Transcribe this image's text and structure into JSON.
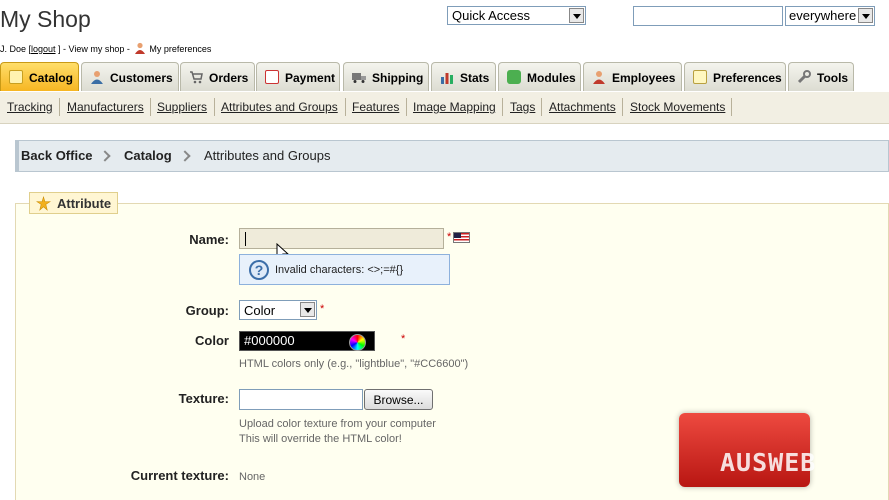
{
  "header": {
    "shop_title": "My Shop",
    "user_name": "J. Doe [",
    "logout_label": "logout",
    "user_mid": " ] - ",
    "view_shop": "View my shop",
    "dash": " - ",
    "preferences_link": "My preferences"
  },
  "top_controls": {
    "quick_access": "Quick Access",
    "search_value": "",
    "search_scope": "everywhere"
  },
  "tabs": [
    {
      "label": "Catalog",
      "icon": "catalog-icon",
      "active": true
    },
    {
      "label": "Customers",
      "icon": "customers-icon"
    },
    {
      "label": "Orders",
      "icon": "cart-icon"
    },
    {
      "label": "Payment",
      "icon": "payment-icon"
    },
    {
      "label": "Shipping",
      "icon": "truck-icon"
    },
    {
      "label": "Stats",
      "icon": "stats-icon"
    },
    {
      "label": "Modules",
      "icon": "puzzle-icon"
    },
    {
      "label": "Employees",
      "icon": "employee-icon"
    },
    {
      "label": "Preferences",
      "icon": "preferences-icon"
    },
    {
      "label": "Tools",
      "icon": "wrench-icon"
    }
  ],
  "subnav": [
    "Tracking",
    "Manufacturers",
    "Suppliers",
    "Attributes and Groups",
    "Features",
    "Image Mapping",
    "Tags",
    "Attachments",
    "Stock Movements"
  ],
  "breadcrumb": [
    "Back Office",
    "Catalog",
    "Attributes and Groups"
  ],
  "form": {
    "legend": "Attribute",
    "name_label": "Name:",
    "name_value": "",
    "hint": "Invalid characters: <>;=#{}",
    "group_label": "Group:",
    "group_value": "Color",
    "color_label": "Color",
    "color_value": "#000000",
    "color_help": "HTML colors only (e.g., \"lightblue\", \"#CC6600\")",
    "texture_label": "Texture:",
    "browse_label": "Browse...",
    "texture_help_1": "Upload color texture from your computer",
    "texture_help_2": "This will override the HTML color!",
    "current_texture_label": "Current texture:",
    "current_texture_value": "None",
    "required_mark": "*"
  },
  "watermark": "AUSWEB",
  "colors": {
    "active_tab": "#f6b622",
    "form_bg": "#fffff0",
    "breadcrumb_bg": "#e5ebef",
    "watermark_red": "#d22a22"
  }
}
